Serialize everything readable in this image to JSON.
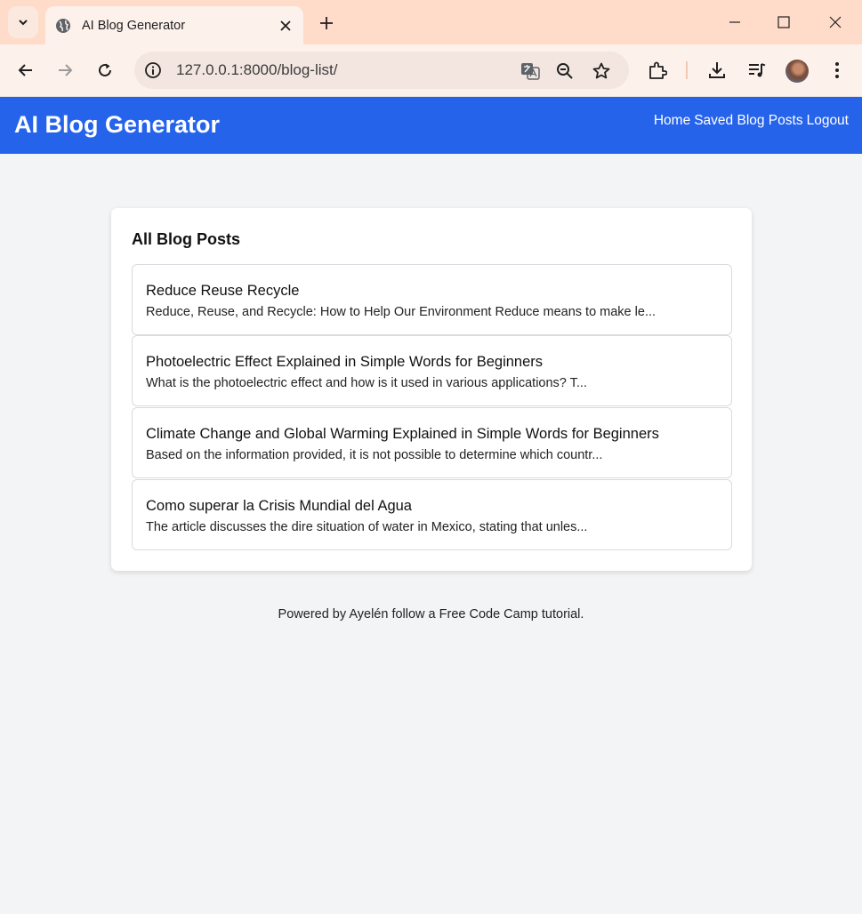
{
  "browser": {
    "tab_title": "AI Blog Generator",
    "url": "127.0.0.1:8000/blog-list/",
    "icons": [
      "tab-search-icon",
      "globe-icon",
      "close-icon",
      "plus-icon",
      "minimize-icon",
      "maximize-icon",
      "window-close-icon",
      "back-icon",
      "forward-icon",
      "reload-icon",
      "info-icon",
      "translate-icon",
      "zoom-icon",
      "star-icon",
      "extensions-icon",
      "download-icon",
      "media-icon",
      "profile-avatar",
      "more-icon"
    ],
    "theme_color": "#ffdcc9"
  },
  "header": {
    "title": "AI Blog Generator",
    "nav": [
      "Home",
      "Saved Blog Posts",
      "Logout"
    ],
    "color": "#2563eb"
  },
  "main": {
    "heading": "All Blog Posts",
    "posts": [
      {
        "title": "Reduce Reuse Recycle",
        "excerpt": "Reduce, Reuse, and Recycle: How to Help Our Environment Reduce means to make le..."
      },
      {
        "title": "Photoelectric Effect Explained in Simple Words for Beginners",
        "excerpt": "What is the photoelectric effect and how is it used in various applications? T..."
      },
      {
        "title": "Climate Change and Global Warming Explained in Simple Words for Beginners",
        "excerpt": "Based on the information provided, it is not possible to determine which countr..."
      },
      {
        "title": "Como superar la Crisis Mundial del Agua",
        "excerpt": "The article discusses the dire situation of water in Mexico, stating that unles..."
      }
    ]
  },
  "footer": {
    "text": "Powered by Ayelén follow a Free Code Camp tutorial."
  }
}
